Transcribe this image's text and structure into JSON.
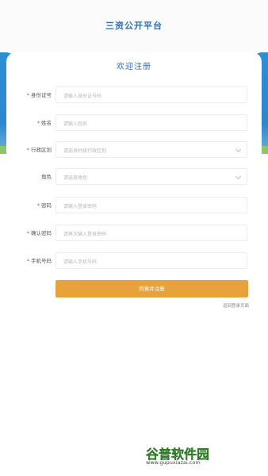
{
  "header": {
    "title": "三资公开平台"
  },
  "card": {
    "title": "欢迎注册"
  },
  "form": {
    "fields": [
      {
        "label": "身份证号",
        "required": true,
        "placeholder": "请输入身份证号码",
        "type": "input"
      },
      {
        "label": "姓名",
        "required": true,
        "placeholder": "请输入姓名",
        "type": "input"
      },
      {
        "label": "行政区划",
        "required": true,
        "placeholder": "请选择村级行政区划",
        "type": "select"
      },
      {
        "label": "角色",
        "required": false,
        "placeholder": "请选择角色",
        "type": "select"
      },
      {
        "label": "密码",
        "required": true,
        "placeholder": "请输入登录密码",
        "type": "input"
      },
      {
        "label": "确认密码",
        "required": true,
        "placeholder": "请再次输入登录密码",
        "type": "input"
      },
      {
        "label": "手机号码",
        "required": true,
        "placeholder": "请输入手机号码",
        "type": "input"
      }
    ],
    "required_mark": "*",
    "submit_label": "同意并注册",
    "back_link": "返回登录页面"
  },
  "watermark": {
    "logo_text": "谷普软件园",
    "url": "www.gupuxiazai.com"
  },
  "colors": {
    "accent": "#2f6fb0",
    "button": "#e8a23b",
    "required": "#e0413b"
  },
  "icons": {
    "select": "chevron-down-icon"
  }
}
